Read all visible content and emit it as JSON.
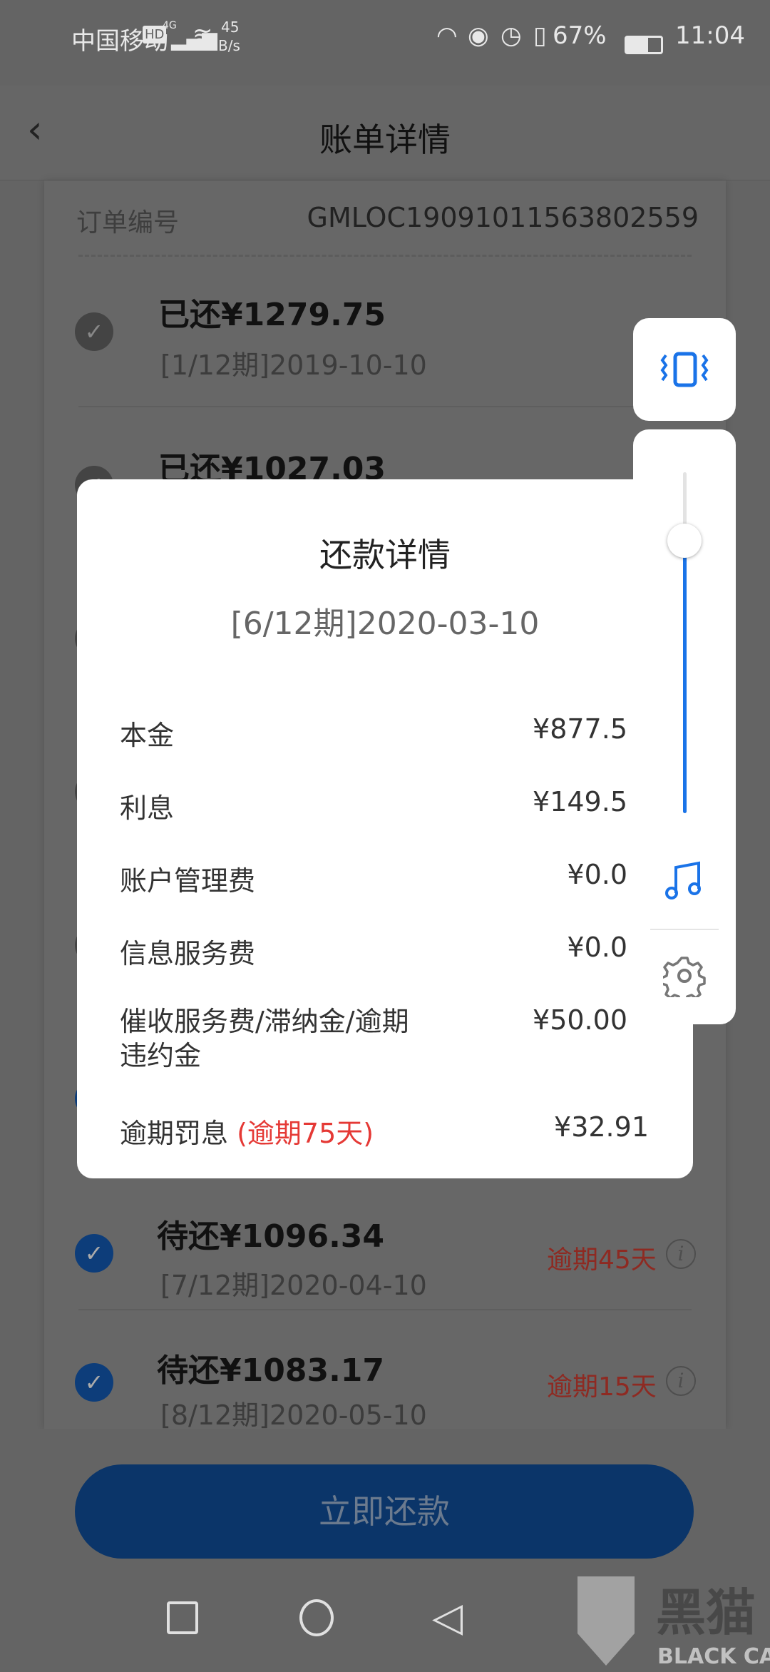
{
  "status_bar": {
    "carrier": "中国移动",
    "hd": "HD",
    "network": "4G",
    "speed_value": "45",
    "speed_unit": "B/s",
    "battery": "67%",
    "time": "11:04"
  },
  "header": {
    "title": "账单详情"
  },
  "order": {
    "label": "订单编号",
    "value": "GMLOC19091011563802559"
  },
  "bills": [
    {
      "amount": "已还¥1279.75",
      "period": "[1/12期]2019-10-10",
      "status": "paid"
    },
    {
      "amount": "已还¥1027.03",
      "status": "paid"
    },
    {
      "amount": "待还¥1096.34",
      "period": "[7/12期]2020-04-10",
      "overdue": "逾期45天",
      "status": "selected"
    },
    {
      "amount": "待还¥1083.17",
      "period": "[8/12期]2020-05-10",
      "overdue": "逾期15天",
      "status": "selected"
    }
  ],
  "pay_button": "立即还款",
  "modal": {
    "title": "还款详情",
    "subtitle": "[6/12期]2020-03-10",
    "rows": [
      {
        "label": "本金",
        "value": "¥877.5"
      },
      {
        "label": "利息",
        "value": "¥149.5"
      },
      {
        "label": "账户管理费",
        "value": "¥0.0"
      },
      {
        "label": "信息服务费",
        "value": "¥0.0"
      },
      {
        "label": "催收服务费/滞纳金/逾期违约金",
        "value": "¥50.00"
      },
      {
        "label": "逾期罚息",
        "note": "(逾期75天)",
        "value": "¥32.91"
      }
    ]
  },
  "volume_panel": {
    "level": 0.8,
    "icons": [
      "vibrate-icon",
      "music-note-icon",
      "gear-icon"
    ],
    "accent": "#1a73e8"
  },
  "nav_bar": {
    "icons": [
      "recents-icon",
      "home-icon",
      "back-icon"
    ]
  },
  "watermark": {
    "text_cn": "黑猫",
    "text_en": "BLACK CAT"
  },
  "colors": {
    "accent": "#1a73e8",
    "overdue": "#e53935"
  }
}
